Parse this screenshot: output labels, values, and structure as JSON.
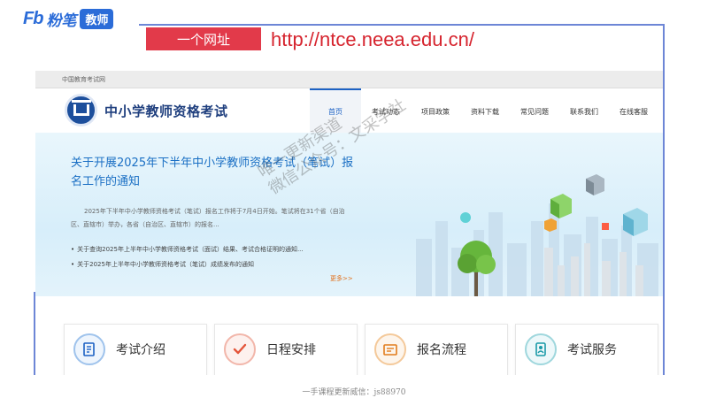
{
  "brand": {
    "mark": "Fb",
    "name": "粉笔",
    "badge": "教师"
  },
  "header": {
    "tag": "一个网址",
    "url": "http://ntce.neea.edu.cn/"
  },
  "site": {
    "topbar": "中国教育考试网",
    "title": "中小学教师资格考试",
    "nav": [
      {
        "label": "首页",
        "active": true
      },
      {
        "label": "考试动态"
      },
      {
        "label": "项目政策"
      },
      {
        "label": "资料下载"
      },
      {
        "label": "常见问题"
      },
      {
        "label": "联系我们"
      },
      {
        "label": "在线客服"
      }
    ],
    "banner": {
      "title": "关于开展2025年下半年中小学教师资格考试（笔试）报名工作的通知",
      "summary": "2025年下半年中小学教师资格考试（笔试）报名工作将于7月4日开始。笔试将在31个省（自治区、直辖市）举办，各省（自治区、直辖市）的报名...",
      "news": [
        "关于查询2025年上半年中小学教师资格考试（面试）结果、考试合格证明的通知...",
        "关于2025年上半年中小学教师资格考试（笔试）成绩发布的通知"
      ],
      "more": "更多>>"
    },
    "cards": [
      {
        "label": "考试介绍",
        "icon": "document-icon"
      },
      {
        "label": "日程安排",
        "icon": "check-icon"
      },
      {
        "label": "报名流程",
        "icon": "form-icon"
      },
      {
        "label": "考试服务",
        "icon": "contact-icon"
      }
    ]
  },
  "watermark": {
    "line1": "唯一更新渠道",
    "line2": "微信公众号：文采学社"
  },
  "footer": {
    "note": "一手课程更新威信：js88970"
  },
  "colors": {
    "accent": "#2b6cd8",
    "tag": "#e23a4a",
    "url": "#d6242e",
    "site_blue": "#1d62c4"
  }
}
